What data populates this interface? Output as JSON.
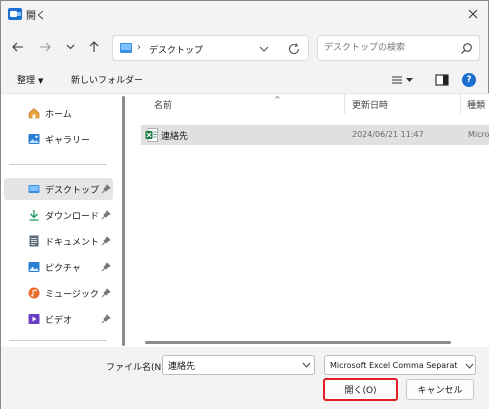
{
  "window": {
    "title": "開く"
  },
  "nav": {
    "address_path": "デスクトップ",
    "address_separator": "›",
    "search_placeholder": "デスクトップの検索"
  },
  "toolbar": {
    "organize_label": "整理",
    "new_folder_label": "新しいフォルダー",
    "help_label": "?"
  },
  "sidebar": {
    "quick": [
      {
        "label": "ホーム",
        "icon": "home-icon"
      },
      {
        "label": "ギャラリー",
        "icon": "gallery-icon"
      }
    ],
    "pinned": [
      {
        "label": "デスクトップ",
        "icon": "desktop-icon",
        "selected": true
      },
      {
        "label": "ダウンロード",
        "icon": "download-icon"
      },
      {
        "label": "ドキュメント",
        "icon": "documents-icon"
      },
      {
        "label": "ピクチャ",
        "icon": "pictures-icon"
      },
      {
        "label": "ミュージック",
        "icon": "music-icon"
      },
      {
        "label": "ビデオ",
        "icon": "videos-icon"
      }
    ]
  },
  "filelist": {
    "columns": {
      "name": "名前",
      "modified": "更新日時",
      "type": "種類"
    },
    "sort_indicator": "^",
    "files": [
      {
        "name": "連絡先",
        "modified": "2024/06/21 11:47",
        "type": "Micro",
        "icon": "excel-file-icon",
        "selected": true
      }
    ]
  },
  "bottom": {
    "filename_label": "ファイル名(N):",
    "filename_value": "連絡先",
    "filetype_value": "Microsoft Excel Comma Separat",
    "open_label": "開く(O)",
    "cancel_label": "キャンセル"
  },
  "colors": {
    "highlight": "#e31e24",
    "accent": "#1a6fd0",
    "selected_row": "#e0e0e0",
    "excel_green": "#1d7a43"
  }
}
